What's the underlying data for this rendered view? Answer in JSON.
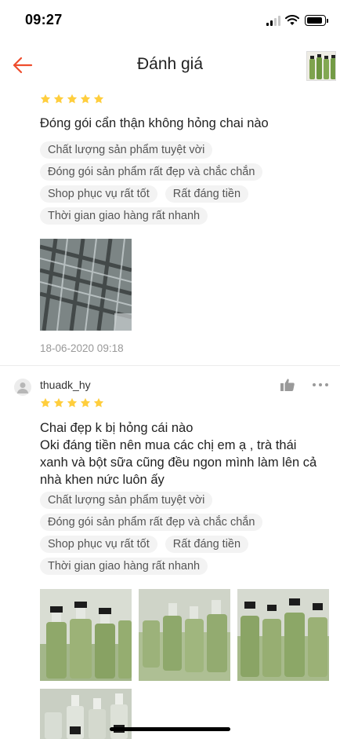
{
  "status_bar": {
    "time": "09:27"
  },
  "header": {
    "title": "Đánh giá"
  },
  "reviews": [
    {
      "rating": 5,
      "text": "Đóng gói cẩn thận không hỏng chai nào",
      "tags": [
        [
          "Chất lượng sản phẩm tuyệt vời"
        ],
        [
          "Đóng gói sản phẩm rất đẹp và chắc chắn"
        ],
        [
          "Shop phục vụ rất tốt",
          "Rất đáng tiền"
        ],
        [
          "Thời gian giao hàng rất nhanh"
        ]
      ],
      "timestamp": "18-06-2020 09:18"
    },
    {
      "username": "thuadk_hy",
      "rating": 5,
      "text_lines": [
        "Chai đẹp k bị hỏng cái nào",
        "Oki đáng tiền nên mua các chị em ạ , trà thái",
        "xanh và bột sữa cũng đều ngon mình làm lên cả",
        "nhà khen nức luôn ấy"
      ],
      "tags": [
        [
          "Chất lượng sản phẩm tuyệt vời"
        ],
        [
          "Đóng gói sản phẩm rất đẹp và chắc chắn"
        ],
        [
          "Shop phục vụ rất tốt",
          "Rất đáng tiền"
        ],
        [
          "Thời gian giao hàng rất nhanh"
        ]
      ]
    }
  ],
  "colors": {
    "accent": "#ee4d2d",
    "star": "#ffce3d"
  }
}
